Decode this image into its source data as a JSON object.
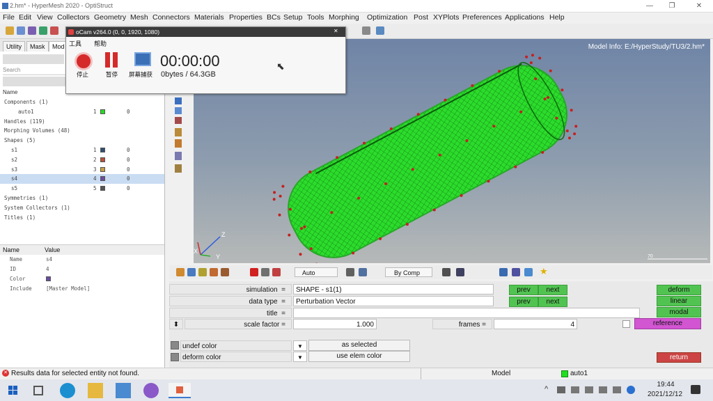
{
  "window": {
    "title": "2.hm* - HyperMesh 2020 - OptiStruct",
    "controls": [
      "—",
      "❐",
      "✕"
    ]
  },
  "menu": [
    "File",
    "Edit",
    "View",
    "Collectors",
    "Geometry",
    "Mesh",
    "Connectors",
    "Materials",
    "Properties",
    "BCs",
    "Setup",
    "Tools",
    "Morphing",
    "Optimization",
    "Post",
    "XYPlots",
    "Preferences",
    "Applications",
    "Help"
  ],
  "left_panel": {
    "tabs": [
      "Utility",
      "Mask",
      "Mod"
    ],
    "search_placeholder": "Search",
    "tree_header": "Name",
    "tree": [
      {
        "label": "Components (1)",
        "indent": 0
      },
      {
        "label": "auto1",
        "indent": 2,
        "id": "1",
        "color": "#22dd22",
        "inc": "0"
      },
      {
        "label": "Handles (119)",
        "indent": 0
      },
      {
        "label": "Morphing Volumes (48)",
        "indent": 0
      },
      {
        "label": "Shapes (5)",
        "indent": 0
      },
      {
        "label": "s1",
        "indent": 1,
        "id": "1",
        "color": "#2f4f6f",
        "inc": "0"
      },
      {
        "label": "s2",
        "indent": 1,
        "id": "2",
        "color": "#b8503a",
        "inc": "0"
      },
      {
        "label": "s3",
        "indent": 1,
        "id": "3",
        "color": "#c8a040",
        "inc": "0"
      },
      {
        "label": "s4",
        "indent": 1,
        "id": "4",
        "color": "#6a4ca0",
        "inc": "0",
        "selected": true
      },
      {
        "label": "s5",
        "indent": 1,
        "id": "5",
        "color": "#555555",
        "inc": "0"
      },
      {
        "label": "Symmetries (1)",
        "indent": 0
      },
      {
        "label": "System Collectors (1)",
        "indent": 0
      },
      {
        "label": "Titles (1)",
        "indent": 0
      }
    ],
    "props_header": {
      "name": "Name",
      "value": "Value"
    },
    "props": [
      {
        "name": "Name",
        "value": "s4"
      },
      {
        "name": "ID",
        "value": "4"
      },
      {
        "name": "Color",
        "value": "",
        "color": "#6a4ca0"
      },
      {
        "name": "Include",
        "value": "[Master Model]"
      }
    ]
  },
  "graphics": {
    "model_info": "Model Info: E:/HyperStudy/TU3/2.hm*",
    "axes": {
      "z": "Z",
      "x": "X",
      "y": "Y"
    },
    "scale_text": "70"
  },
  "bottom_toolbar": {
    "auto_label": "Auto",
    "bycomp_label": "By Comp"
  },
  "panel": {
    "simulation_label": "simulation",
    "simulation_value": "SHAPE - s1(1)",
    "data_type_label": "data type",
    "data_type_value": "Perturbation Vector",
    "title_label": "title",
    "title_value": "",
    "scale_label": "scale factor =",
    "scale_value": "1.000",
    "frames_label": "frames =",
    "frames_value": "4",
    "prev": "prev",
    "next": "next",
    "deform": "deform",
    "linear": "linear",
    "modal": "modal",
    "reference": "reference",
    "return": "return",
    "undef_color": "undef color",
    "deform_color": "deform color",
    "as_selected": "as selected",
    "use_elem_color": "use elem color"
  },
  "status": {
    "message": "Results data for selected entity not found.",
    "model": "Model",
    "component": "auto1"
  },
  "recorder": {
    "title": "oCam v264.0 (0, 0, 1920, 1080)",
    "menu": [
      "工具",
      "帮助"
    ],
    "buttons": [
      "停止",
      "暂停",
      "屏幕捕获"
    ],
    "time": "00:00:00",
    "size": "0bytes / 64.3GB"
  },
  "taskbar": {
    "time": "19:44",
    "date": "2021/12/12"
  }
}
